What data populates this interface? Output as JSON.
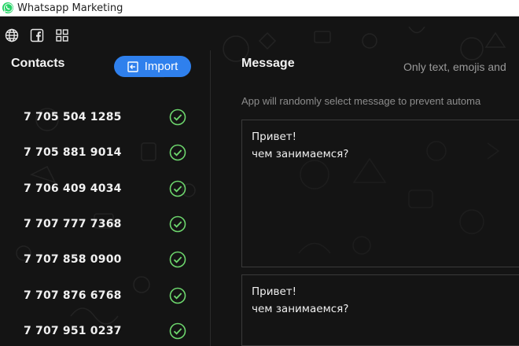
{
  "window": {
    "title": "Whatsapp Marketing",
    "app_icon": "whatsapp-logo-icon"
  },
  "toolbar": {
    "icons": [
      "globe-icon",
      "facebook-icon",
      "grid-icon"
    ]
  },
  "contacts": {
    "title": "Contacts",
    "import_label": "Import",
    "items": [
      {
        "number": "7 705 504 1285",
        "status": "check-icon"
      },
      {
        "number": "7 705 881 9014",
        "status": "check-icon"
      },
      {
        "number": "7 706 409 4034",
        "status": "check-icon"
      },
      {
        "number": "7 707 777 7368",
        "status": "check-icon"
      },
      {
        "number": "7 707 858 0900",
        "status": "check-icon"
      },
      {
        "number": "7 707 876 6768",
        "status": "check-icon"
      },
      {
        "number": "7 707 951 0237",
        "status": "check-icon"
      }
    ]
  },
  "message": {
    "title": "Message",
    "hint": "Only text, emojis and",
    "random_note": "App will randomly select message to prevent automa",
    "boxes": [
      {
        "line1": "Привет!",
        "line2": "чем занимаемся?"
      },
      {
        "line1": "Привет!",
        "line2": "чем занимаемся?"
      }
    ]
  },
  "colors": {
    "accent": "#2f80ed",
    "check": "#6dd66d",
    "background": "#141414"
  }
}
